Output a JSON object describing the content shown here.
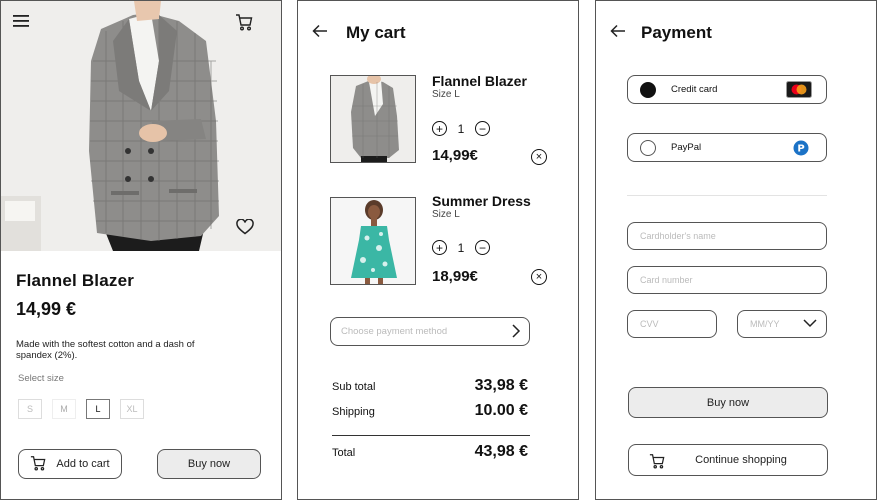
{
  "product": {
    "title": "Flannel Blazer",
    "price": "14,99 €",
    "description": "Made with the softest cotton and a dash of spandex (2%).",
    "size_label": "Select size",
    "sizes": [
      "S",
      "M",
      "L",
      "XL"
    ],
    "selected_size": "L",
    "add_to_cart": "Add to cart",
    "buy_now": "Buy now"
  },
  "cart": {
    "title": "My cart",
    "items": [
      {
        "name": "Flannel Blazer",
        "size": "Size L",
        "qty": "1",
        "price": "14,99€"
      },
      {
        "name": "Summer Dress",
        "size": "Size L",
        "qty": "1",
        "price": "18,99€"
      }
    ],
    "payment_placeholder": "Choose payment method",
    "subtotal_label": "Sub total",
    "subtotal_value": "33,98 €",
    "shipping_label": "Shipping",
    "shipping_value": "10.00 €",
    "total_label": "Total",
    "total_value": "43,98 €"
  },
  "payment": {
    "title": "Payment",
    "options": [
      "Credit card",
      "PayPal"
    ],
    "selected_option": "Credit card",
    "cardholder_placeholder": "Cardholder's name",
    "card_number_placeholder": "Card number",
    "cvv_placeholder": "CVV",
    "expiry_placeholder": "MM/YY",
    "buy_now": "Buy now",
    "continue_shopping": "Continue shopping"
  },
  "colors": {
    "border": "#555555",
    "button_gray": "#ececec",
    "placeholder": "#bbbbbb",
    "dress": "#3bb7a5",
    "mastercard_red": "#eb001b",
    "mastercard_orange": "#f79e1b",
    "paypal_blue": "#1b72c6"
  }
}
